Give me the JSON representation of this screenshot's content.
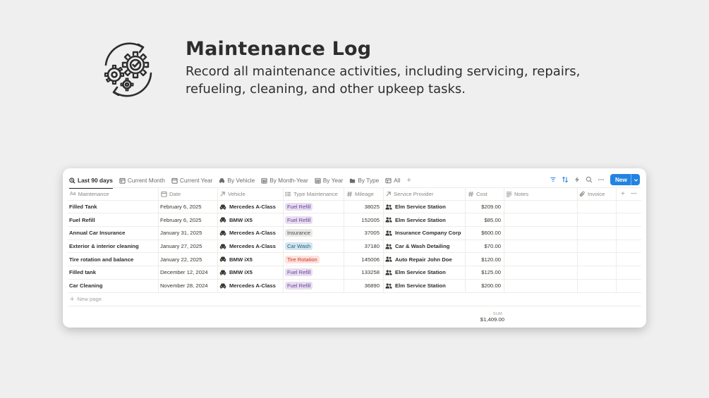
{
  "hero": {
    "title": "Maintenance Log",
    "subtitle": "Record all maintenance activities, including servicing, repairs, refueling, cleaning, and other upkeep tasks.",
    "icon": "gears-refresh-check-icon"
  },
  "views": [
    {
      "label": "Last 90 days",
      "icon": "search-clock-icon",
      "active": true
    },
    {
      "label": "Current Month",
      "icon": "calendar-icon"
    },
    {
      "label": "Current Year",
      "icon": "calendar-icon"
    },
    {
      "label": "By Vehicle",
      "icon": "car-icon"
    },
    {
      "label": "By Month-Year",
      "icon": "calendar-grid-icon"
    },
    {
      "label": "By Year",
      "icon": "calendar-grid-icon"
    },
    {
      "label": "By Type",
      "icon": "folder-icon"
    },
    {
      "label": "All",
      "icon": "table-icon"
    }
  ],
  "toolbar": {
    "add_view": "+",
    "new_label": "New"
  },
  "columns": {
    "name": "Maintenance",
    "name_prefix": "Aa",
    "date": "Date",
    "vehicle": "Vehicle",
    "type": "Type Maintenance",
    "mileage": "Mileage",
    "provider": "Service Provider",
    "cost": "Cost",
    "notes": "Notes",
    "invoice": "Invoice"
  },
  "rows": [
    {
      "name": "Filled Tank",
      "date": "February 6, 2025",
      "vehicle": "Mercedes A-Class",
      "type": "Fuel Refill",
      "mileage": "38025",
      "provider": "Elm Service Station",
      "cost": "$209.00"
    },
    {
      "name": "Fuel Refill",
      "date": "February 6, 2025",
      "vehicle": "BMW iX5",
      "type": "Fuel Refill",
      "mileage": "152005",
      "provider": "Elm Service Station",
      "cost": "$85.00"
    },
    {
      "name": "Annual Car Insurance",
      "date": "January 31, 2025",
      "vehicle": "Mercedes A-Class",
      "type": "Insurance",
      "mileage": "37005",
      "provider": "Insurance Company Corp",
      "cost": "$600.00"
    },
    {
      "name": "Exterior & interior cleaning",
      "date": "January 27, 2025",
      "vehicle": "Mercedes A-Class",
      "type": "Car Wash",
      "mileage": "37180",
      "provider": "Car & Wash Detailing",
      "cost": "$70.00"
    },
    {
      "name": "Tire rotation and balance",
      "date": "January 22, 2025",
      "vehicle": "BMW iX5",
      "type": "Tire Rotation",
      "mileage": "145006",
      "provider": "Auto Repair John Doe",
      "cost": "$120.00"
    },
    {
      "name": "Filled tank",
      "date": "December 12, 2024",
      "vehicle": "BMW iX5",
      "type": "Fuel Refill",
      "mileage": "133258",
      "provider": "Elm Service Station",
      "cost": "$125.00"
    },
    {
      "name": "Car Cleaning",
      "date": "November 28, 2024",
      "vehicle": "Mercedes A-Class",
      "type": "Fuel Refill",
      "mileage": "36890",
      "provider": "Elm Service Station",
      "cost": "$200.00"
    }
  ],
  "tag_colors": {
    "Fuel Refill": {
      "bg": "#e8deee",
      "fg": "#6940a5"
    },
    "Insurance": {
      "bg": "#e9e9e7",
      "fg": "#4a4a47"
    },
    "Car Wash": {
      "bg": "#d3e5ef",
      "fg": "#1f5e80"
    },
    "Tire Rotation": {
      "bg": "#ffe2dd",
      "fg": "#c4362a"
    }
  },
  "new_page_label": "New page",
  "footer": {
    "sum_label": "SUM",
    "sum_value": "$1,409.00"
  },
  "colors": {
    "accent": "#2383e2",
    "background": "#efefef"
  }
}
